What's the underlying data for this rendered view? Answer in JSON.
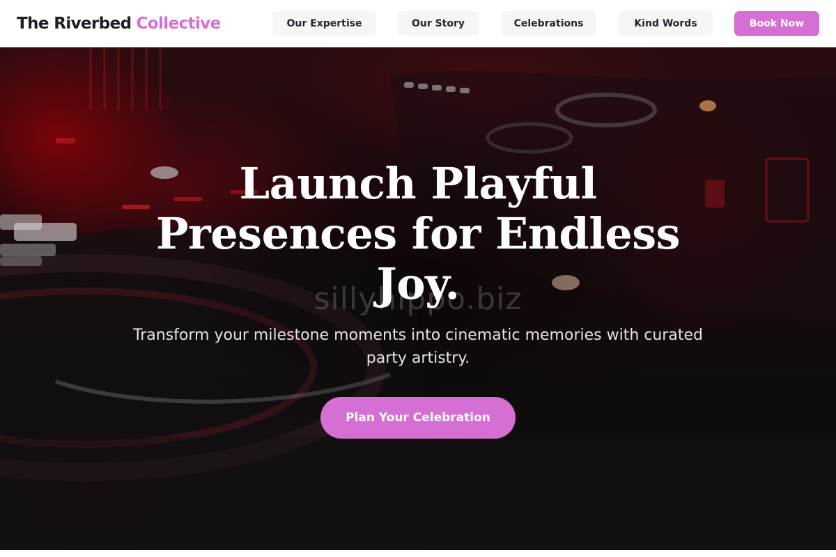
{
  "brand": {
    "name_primary": "The Riverbed",
    "name_accent": "Collective"
  },
  "nav": {
    "items": [
      {
        "label": "Our Expertise"
      },
      {
        "label": "Our Story"
      },
      {
        "label": "Celebrations"
      },
      {
        "label": "Kind Words"
      }
    ],
    "cta_label": "Book Now"
  },
  "hero": {
    "headline": "Launch Playful Presences for Endless Joy.",
    "subheadline": "Transform your milestone moments into cinematic memories with curated party artistry.",
    "cta_label": "Plan Your Celebration",
    "watermark": "sillyhippo.biz",
    "background_subject": "dj-mixer-photo"
  },
  "colors": {
    "accent": "#d56fd3",
    "text_dark": "#1d1d28",
    "hero_tint": "#8a0a14"
  }
}
